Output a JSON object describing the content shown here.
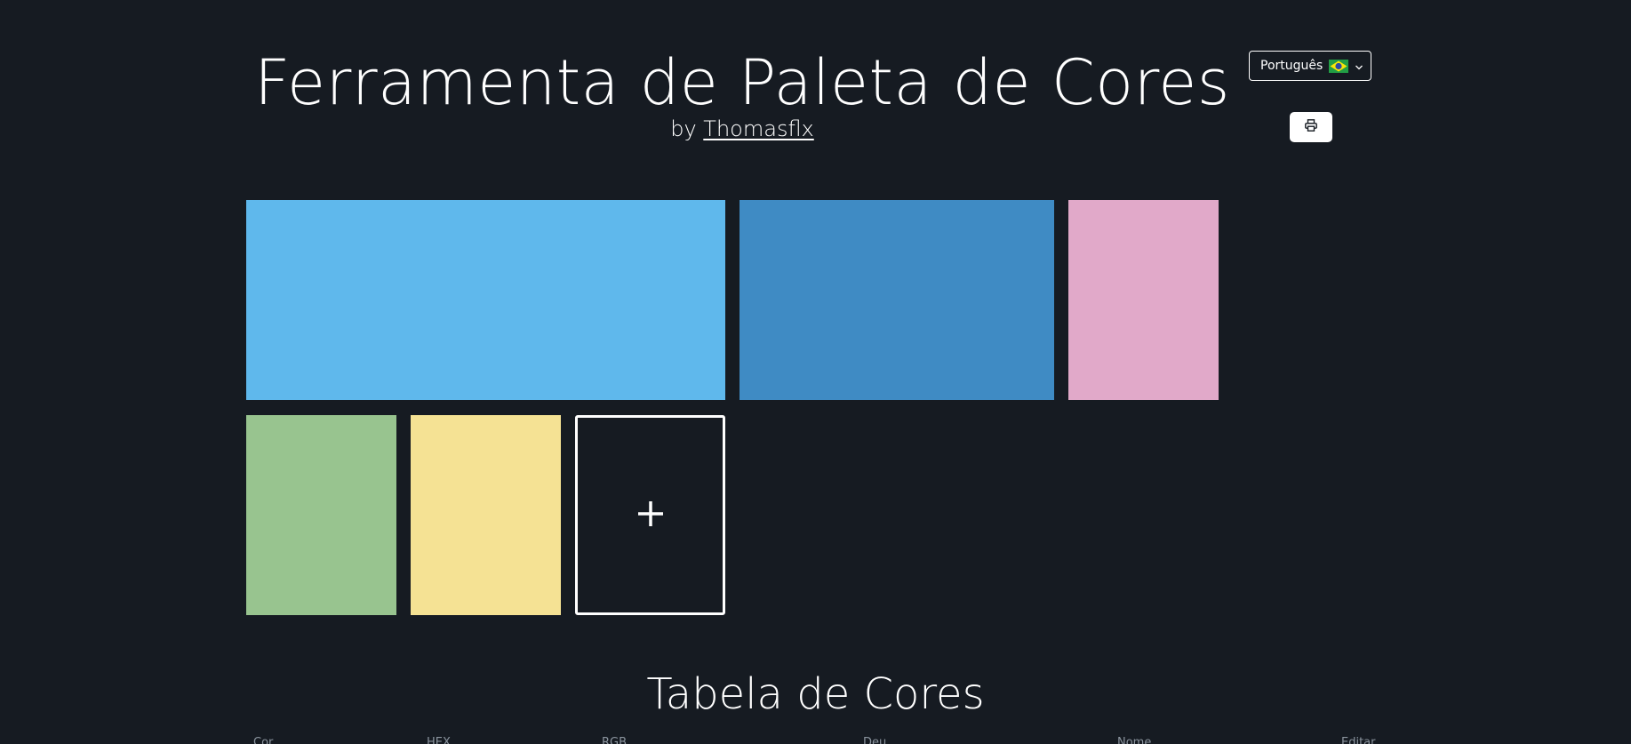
{
  "header": {
    "title": "Ferramenta de Paleta de Cores",
    "by_prefix": "by ",
    "author": "Thomasflx"
  },
  "language": {
    "selected": "Português",
    "flag_icon": "brazil-flag-icon",
    "dropdown_icon": "chevron-down-icon"
  },
  "print_button": {
    "icon": "printer-icon"
  },
  "palette": {
    "swatches": [
      {
        "color": "#5fb8ec"
      },
      {
        "color": "#3f8bc4"
      },
      {
        "color": "#e1a9c9"
      },
      {
        "color": "#98c48f"
      },
      {
        "color": "#f5e294"
      }
    ],
    "add_label": "+",
    "add_icon": "plus-icon"
  },
  "table": {
    "title": "Tabela de Cores",
    "columns": [
      "Cor",
      "HEX",
      "RGB",
      "Deu",
      "Nome",
      "Editar"
    ]
  }
}
